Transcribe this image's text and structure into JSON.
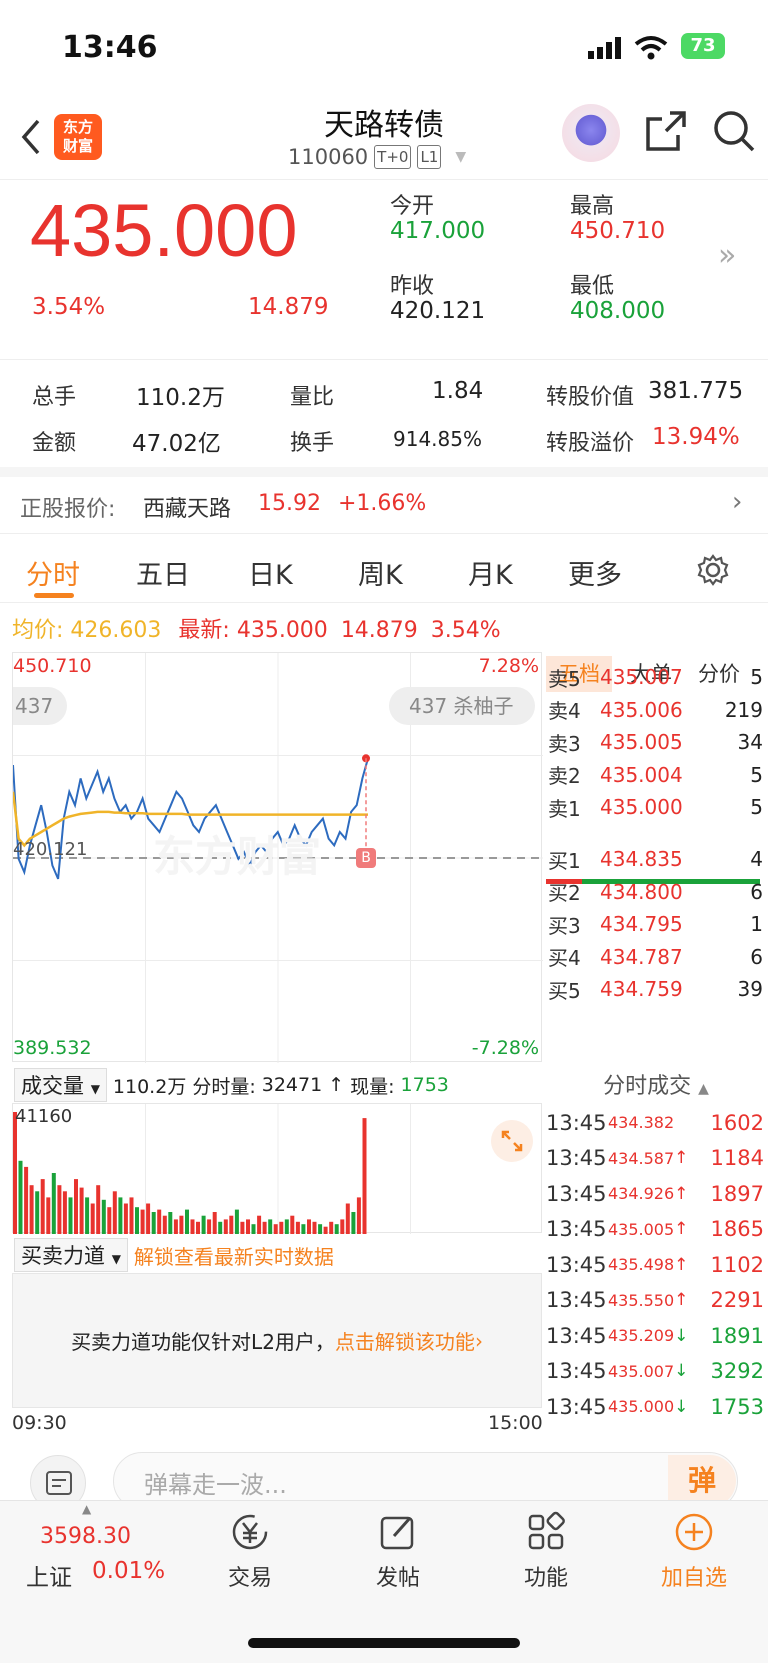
{
  "status_bar": {
    "time": "13:46",
    "battery": "73"
  },
  "header": {
    "title": "天路转债",
    "code": "110060",
    "tag1": "T+0",
    "tag2": "L1",
    "logo_line1": "东方",
    "logo_line2": "财富"
  },
  "quote": {
    "price": "435.000",
    "change_pct": "3.54%",
    "change": "14.879",
    "open_label": "今开",
    "open": "417.000",
    "high_label": "最高",
    "high": "450.710",
    "prev_close_label": "昨收",
    "prev_close": "420.121",
    "low_label": "最低",
    "low": "408.000"
  },
  "stats": {
    "volume_label": "总手",
    "volume": "110.2万",
    "vol_ratio_label": "量比",
    "vol_ratio": "1.84",
    "conv_value_label": "转股价值",
    "conv_value": "381.775",
    "amount_label": "金额",
    "amount": "47.02亿",
    "turnover_label": "换手",
    "turnover": "914.85%",
    "premium_label": "转股溢价",
    "premium": "13.94%"
  },
  "underlying": {
    "label": "正股报价:",
    "name": "西藏天路",
    "price": "15.92",
    "change": "+1.66%"
  },
  "tabs": [
    "分时",
    "五日",
    "日K",
    "周K",
    "月K",
    "更多"
  ],
  "chart_info": {
    "avg_label": "均价:",
    "avg": "426.603",
    "latest_label": "最新:",
    "latest": "435.000",
    "latest_change": "14.879",
    "latest_pct": "3.54%",
    "top_price": "450.710",
    "top_pct": "7.28%",
    "bottom_price": "389.532",
    "bottom_pct": "-7.28%",
    "baseline": "420.121",
    "comment_left": "437",
    "comment_right": "437 杀柚子",
    "watermark": "东方财富",
    "marker": "B"
  },
  "chart_data": {
    "type": "line",
    "title": "",
    "ylim": [
      389.532,
      450.71
    ],
    "baseline": 420.121,
    "series": [
      {
        "values": [
          434,
          420,
          418,
          422,
          425,
          428,
          424,
          419,
          417,
          426,
          430,
          428,
          432,
          429,
          431,
          433,
          430,
          432,
          429,
          427,
          428,
          426,
          427,
          429,
          426,
          425,
          424,
          426,
          428,
          430,
          429,
          427,
          425,
          424,
          426,
          427,
          428,
          426,
          424,
          422,
          420,
          421,
          419,
          421,
          422,
          421,
          423,
          424,
          422,
          423,
          425,
          423,
          422,
          424,
          425,
          426,
          423,
          422,
          424,
          423,
          427,
          428,
          432,
          435
        ]
      },
      {
        "values": [
          430,
          423,
          422,
          423,
          423.5,
          424,
          424.5,
          425,
          425.5,
          426,
          426.3,
          426.5,
          426.7,
          426.8,
          426.9,
          427,
          427,
          427,
          426.9,
          426.9,
          426.8,
          426.8,
          426.8,
          426.8,
          426.7,
          426.7,
          426.7,
          426.7,
          426.7,
          426.7,
          426.7,
          426.6,
          426.6,
          426.6,
          426.6,
          426.6,
          426.6,
          426.6,
          426.6,
          426.6,
          426.6,
          426.6,
          426.6,
          426.6,
          426.6,
          426.6,
          426.6,
          426.6,
          426.6,
          426.6,
          426.6,
          426.6,
          426.6,
          426.6,
          426.6,
          426.6,
          426.6,
          426.6,
          426.6,
          426.6,
          426.6,
          426.6,
          426.6,
          426.6
        ]
      }
    ],
    "volume": {
      "max": "41160",
      "bars": [
        100,
        60,
        55,
        40,
        35,
        45,
        30,
        50,
        40,
        35,
        30,
        45,
        38,
        30,
        25,
        40,
        28,
        22,
        35,
        30,
        25,
        30,
        22,
        20,
        25,
        18,
        20,
        15,
        18,
        12,
        15,
        20,
        12,
        10,
        15,
        12,
        18,
        10,
        12,
        15,
        20,
        10,
        12,
        8,
        15,
        10,
        12,
        8,
        10,
        12,
        15,
        10,
        8,
        12,
        10,
        8,
        6,
        10,
        8,
        12,
        25,
        18,
        30,
        95
      ],
      "colors": [
        "red",
        "green"
      ]
    }
  },
  "orderbook": {
    "tabs": [
      "五档",
      "大单",
      "分价"
    ],
    "asks": [
      {
        "label": "卖5",
        "price": "435.007",
        "vol": "5"
      },
      {
        "label": "卖4",
        "price": "435.006",
        "vol": "219"
      },
      {
        "label": "卖3",
        "price": "435.005",
        "vol": "34"
      },
      {
        "label": "卖2",
        "price": "435.004",
        "vol": "5"
      },
      {
        "label": "卖1",
        "price": "435.000",
        "vol": "5"
      }
    ],
    "bids": [
      {
        "label": "买1",
        "price": "434.835",
        "vol": "4"
      },
      {
        "label": "买2",
        "price": "434.800",
        "vol": "6"
      },
      {
        "label": "买3",
        "price": "434.795",
        "vol": "1"
      },
      {
        "label": "买4",
        "price": "434.787",
        "vol": "6"
      },
      {
        "label": "买5",
        "price": "434.759",
        "vol": "39"
      }
    ]
  },
  "trades": {
    "title": "分时成交",
    "rows": [
      {
        "time": "13:45",
        "price": "434.382",
        "arrow": "",
        "vol": "1602"
      },
      {
        "time": "13:45",
        "price": "434.587",
        "arrow": "↑",
        "vol": "1184"
      },
      {
        "time": "13:45",
        "price": "434.926",
        "arrow": "↑",
        "vol": "1897"
      },
      {
        "time": "13:45",
        "price": "435.005",
        "arrow": "↑",
        "vol": "1865"
      },
      {
        "time": "13:45",
        "price": "435.498",
        "arrow": "↑",
        "vol": "1102"
      },
      {
        "time": "13:45",
        "price": "435.550",
        "arrow": "↑",
        "vol": "2291"
      },
      {
        "time": "13:45",
        "price": "435.209",
        "arrow": "↓",
        "vol": "1891"
      },
      {
        "time": "13:45",
        "price": "435.007",
        "arrow": "↓",
        "vol": "3292"
      },
      {
        "time": "13:45",
        "price": "435.000",
        "arrow": "↓",
        "vol": "1753"
      }
    ]
  },
  "volume_header": {
    "select": "成交量",
    "total": "110.2万",
    "segment_label": "分时量:",
    "segment": "32471 ↑",
    "now_label": "现量:",
    "now": "1753"
  },
  "moneyflow": {
    "select": "买卖力道",
    "unlock": "解锁查看最新实时数据",
    "notice": "买卖力道功能仅针对L2用户，",
    "notice_link": "点击解锁该功能"
  },
  "time_axis": {
    "start": "09:30",
    "end": "15:00"
  },
  "danmu": {
    "placeholder": "弹幕走一波...",
    "button": "弹"
  },
  "bottom_nav": {
    "index_value": "3598.30",
    "index_name": "上证",
    "index_pct": "0.01%",
    "items": [
      "交易",
      "发帖",
      "功能",
      "加自选"
    ]
  }
}
